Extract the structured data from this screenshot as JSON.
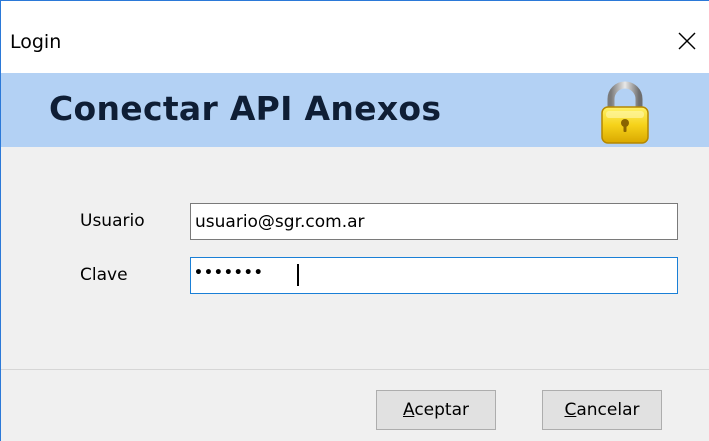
{
  "window": {
    "title": "Login"
  },
  "header": {
    "title": "Conectar API Anexos",
    "icon": "padlock-icon"
  },
  "form": {
    "user_label": "Usuario",
    "user_value": "usuario@sgr.com.ar",
    "password_label": "Clave",
    "password_masked": "•••••••"
  },
  "buttons": {
    "accept_accel": "A",
    "accept_rest": "ceptar",
    "cancel_accel": "C",
    "cancel_rest": "ancelar"
  },
  "colors": {
    "header_bg": "#b3d1f4",
    "focus_border": "#1a7fd6",
    "window_bg": "#f0f0f0"
  }
}
